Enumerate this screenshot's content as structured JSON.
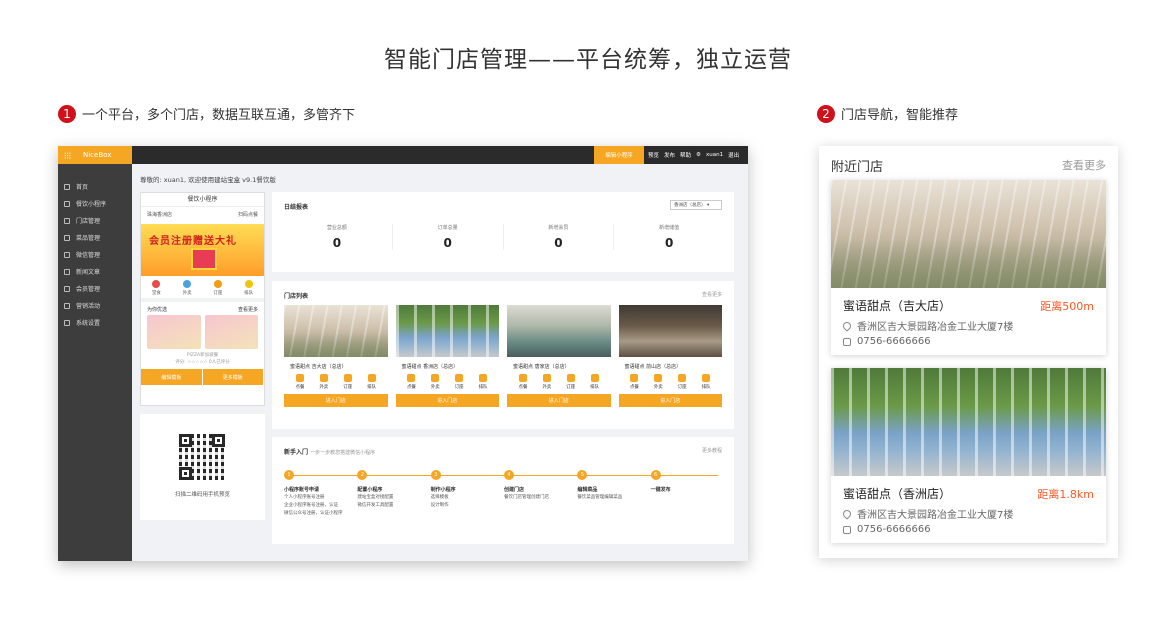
{
  "page": {
    "title": "智能门店管理——平台统筹，独立运营",
    "section1": {
      "num": "1",
      "label": "一个平台，多个门店，数据互联互通，多管齐下"
    },
    "section2": {
      "num": "2",
      "label": "门店导航，智能推荐"
    }
  },
  "admin": {
    "brand": "NiceBox",
    "mp_button": "编辑小程序",
    "top_links": [
      "预览",
      "发布",
      "帮助",
      "⚙",
      "xuan1",
      "退出"
    ],
    "sidebar": [
      {
        "label": "首页",
        "icon": "home-icon"
      },
      {
        "label": "餐饮小程序",
        "icon": "app-icon"
      },
      {
        "label": "门店管理",
        "icon": "store-icon"
      },
      {
        "label": "菜品管理",
        "icon": "dish-icon"
      },
      {
        "label": "微信管理",
        "icon": "wechat-icon"
      },
      {
        "label": "新闻文章",
        "icon": "news-icon"
      },
      {
        "label": "会员管理",
        "icon": "member-icon"
      },
      {
        "label": "营销活动",
        "icon": "tag-icon"
      },
      {
        "label": "系统设置",
        "icon": "gear-icon"
      }
    ],
    "welcome": "尊敬的: xuan1, 欢迎使用建站宝盒 v9.1餐饮版",
    "phone_preview": {
      "header": "餐饮小程序",
      "location": "珠海香洲店",
      "scan": "扫码点餐",
      "banner": "会员注册赠送大礼",
      "icons": [
        {
          "label": "堂食",
          "color": "#e84b4b"
        },
        {
          "label": "外卖",
          "color": "#4aa3df"
        },
        {
          "label": "订座",
          "color": "#f39c12"
        },
        {
          "label": "排队",
          "color": "#f1c40f"
        }
      ],
      "section_title": "为你优选",
      "section_more": "查看更多",
      "meta1": "PIZZA新加坡餐",
      "meta2": "评分: ☆☆☆☆☆    0人已评分",
      "btn1": "编辑模板",
      "btn2": "更多模板"
    },
    "qr_label": "扫描二维码用手机预览",
    "daily": {
      "title": "日结报表",
      "store_select": "香洲店（总店）",
      "stats": [
        {
          "label": "营业总额",
          "value": "0"
        },
        {
          "label": "订单总量",
          "value": "0"
        },
        {
          "label": "新增会员",
          "value": "0"
        },
        {
          "label": "新增储值",
          "value": "0"
        }
      ]
    },
    "stores": {
      "title": "门店列表",
      "more": "查看更多",
      "items": [
        {
          "name": "蜜语甜点 吉大店（总店）"
        },
        {
          "name": "蜜语甜点 香洲店（总店）"
        },
        {
          "name": "蜜语甜点 唐家店（总店）"
        },
        {
          "name": "蜜语甜点 前山店（总店）"
        }
      ],
      "icon_labels": [
        "点餐",
        "外卖",
        "订座",
        "排队"
      ],
      "enter_label": "进入门店"
    },
    "guide": {
      "title": "新手入门",
      "subtitle": "一步一步教您搭建微信小程序",
      "more": "更多教程",
      "steps": [
        {
          "num": "1",
          "title": "小程序账号申请",
          "lines": [
            "个人小程序账号注册",
            "企业小程序账号注册，认证",
            "微信公众号注册，认证小程序"
          ]
        },
        {
          "num": "2",
          "title": "配置小程序",
          "lines": [
            "建站宝盒对接配置",
            "微信开发工具配置"
          ]
        },
        {
          "num": "3",
          "title": "制作小程序",
          "lines": [
            "选择模板",
            "设计制作"
          ]
        },
        {
          "num": "4",
          "title": "创建门店",
          "lines": [
            "餐饮门店管理创建门店"
          ]
        },
        {
          "num": "5",
          "title": "编辑菜品",
          "lines": [
            "餐饮菜品管理编辑菜品"
          ]
        },
        {
          "num": "6",
          "title": "一键发布",
          "lines": []
        }
      ]
    }
  },
  "nearby": {
    "title": "附近门店",
    "more": "查看更多",
    "stores": [
      {
        "name": "蜜语甜点（吉大店）",
        "distance": "距离500m",
        "address": "香洲区吉大景园路冶金工业大厦7楼",
        "phone": "0756-6666666"
      },
      {
        "name": "蜜语甜点（香洲店）",
        "distance": "距离1.8km",
        "address": "香洲区吉大景园路冶金工业大厦7楼",
        "phone": "0756-6666666"
      }
    ]
  },
  "colors": {
    "accent": "#f5a623",
    "badge": "#d0101b",
    "distance": "#ff5722"
  }
}
